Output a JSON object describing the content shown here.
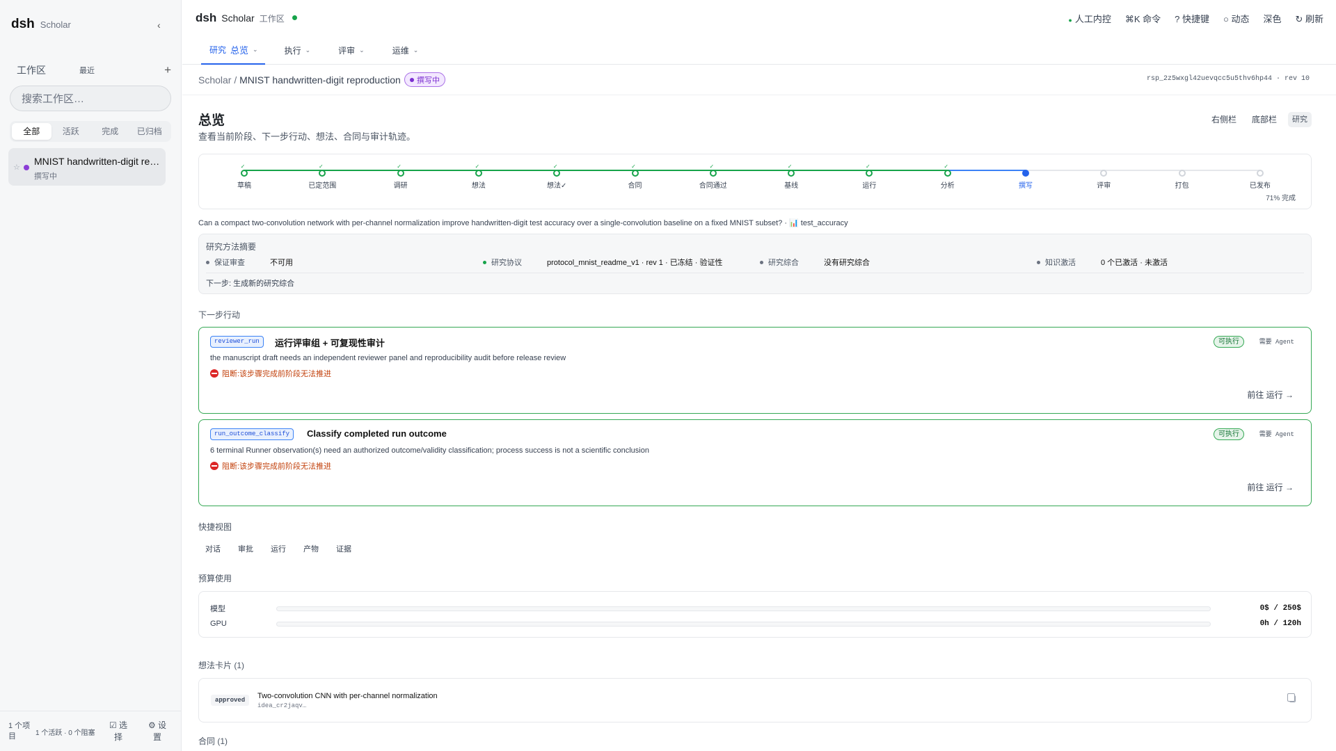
{
  "sidebar": {
    "brand": "dsh",
    "brand_sub": "Scholar",
    "collapse_icon": "‹",
    "workspace_label": "工作区",
    "recent_label": "最近",
    "add_icon": "+",
    "search_placeholder": "搜索工作区…",
    "filters": [
      "全部",
      "活跃",
      "完成",
      "已归档"
    ],
    "active_filter": "全部",
    "item": {
      "star": "☆",
      "name": "MNIST handwritten-digit re…",
      "status": "撰写中"
    },
    "footer": {
      "count": "1 个项目",
      "stats": "1 个活跃 · 0 个阻塞",
      "select": "☑ 选择",
      "settings": "⚙ 设置"
    }
  },
  "header": {
    "brand": "dsh",
    "product": "Scholar",
    "workspace": "工作区",
    "actions": [
      "人工内控",
      "⌘K 命令",
      "? 快捷键",
      "○ 动态",
      "深色",
      "↻ 刷新"
    ],
    "tabs": [
      {
        "label": "研究",
        "sub": "总览",
        "caret": "⌄"
      },
      {
        "label": "执行",
        "sub": "",
        "caret": "⌄"
      },
      {
        "label": "评审",
        "sub": "",
        "caret": "⌄"
      },
      {
        "label": "运维",
        "sub": "",
        "caret": "⌄"
      }
    ]
  },
  "breadcrumb": {
    "root": "Scholar /",
    "title": "MNIST handwritten-digit reproduction",
    "status": "撰写中",
    "rsp": "rsp_2z5wxgl42uevqcc5u5thv6hp44 · rev 10"
  },
  "overview": {
    "title": "总览",
    "subtitle": "查看当前阶段、下一步行动、想法、合同与审计轨迹。",
    "view_buttons": [
      "右侧栏",
      "底部栏",
      "研究"
    ]
  },
  "stages": {
    "items": [
      {
        "label": "草稿",
        "state": "done"
      },
      {
        "label": "已定范围",
        "state": "done"
      },
      {
        "label": "调研",
        "state": "done"
      },
      {
        "label": "想法",
        "state": "done"
      },
      {
        "label": "想法✓",
        "state": "done"
      },
      {
        "label": "合同",
        "state": "done"
      },
      {
        "label": "合同通过",
        "state": "done"
      },
      {
        "label": "基线",
        "state": "done"
      },
      {
        "label": "运行",
        "state": "done"
      },
      {
        "label": "分析",
        "state": "done"
      },
      {
        "label": "撰写",
        "state": "current"
      },
      {
        "label": "评审",
        "state": "todo"
      },
      {
        "label": "打包",
        "state": "todo"
      },
      {
        "label": "已发布",
        "state": "todo"
      }
    ],
    "check_mark": "✓",
    "progress_text": "71% 完成",
    "color_done": "#16a34a",
    "color_current": "#2563eb"
  },
  "question": "Can a compact two-convolution network with per-channel normalization improve handwritten-digit test accuracy over a single-convolution baseline on a fixed MNIST subset? · 📊 test_accuracy",
  "summary": {
    "heading": "研究方法摘要",
    "cells": [
      {
        "key": "保证审查",
        "value": "不可用",
        "dot": "grey"
      },
      {
        "key": "研究协议",
        "value": "protocol_mnist_readme_v1 · rev 1 · 已冻结 · 验证性",
        "dot": "green"
      },
      {
        "key": "研究综合",
        "value": "没有研究综合",
        "dot": "grey"
      },
      {
        "key": "知识激活",
        "value": "0 个已激活 · 未激活",
        "dot": "grey"
      }
    ],
    "next": "下一步: 生成新的研究综合"
  },
  "next_actions": {
    "heading": "下一步行动",
    "items": [
      {
        "tag": "reviewer_run",
        "title": "运行评审组 + 可复现性审计",
        "status": "可执行",
        "agent": "需要 Agent",
        "desc": "the manuscript draft needs an independent reviewer panel and reproducibility audit before release review",
        "warning": "阻断:该步骤完成前阶段无法推进",
        "goto": "前往 运行 →"
      },
      {
        "tag": "run_outcome_classify",
        "title": "Classify completed run outcome",
        "status": "可执行",
        "agent": "需要 Agent",
        "desc": "6 terminal Runner observation(s) need an authorized outcome/validity classification; process success is not a scientific conclusion",
        "warning": "阻断:该步骤完成前阶段无法推进",
        "goto": "前往 运行 →"
      }
    ]
  },
  "quick_views": {
    "heading": "快捷视图",
    "items": [
      "对话",
      "审批",
      "运行",
      "产物",
      "证据"
    ]
  },
  "budget": {
    "heading": "预算使用",
    "rows": [
      {
        "label": "模型",
        "value": "0$ / 250$",
        "fraction": 0
      },
      {
        "label": "GPU",
        "value": "0h / 120h",
        "fraction": 0
      }
    ]
  },
  "ideas": {
    "heading": "想法卡片 (1)",
    "items": [
      {
        "status": "approved",
        "title": "Two-convolution CNN with per-channel normalization",
        "id": "idea_cr2jaqv…"
      }
    ]
  },
  "contracts": {
    "heading": "合同 (1)"
  }
}
